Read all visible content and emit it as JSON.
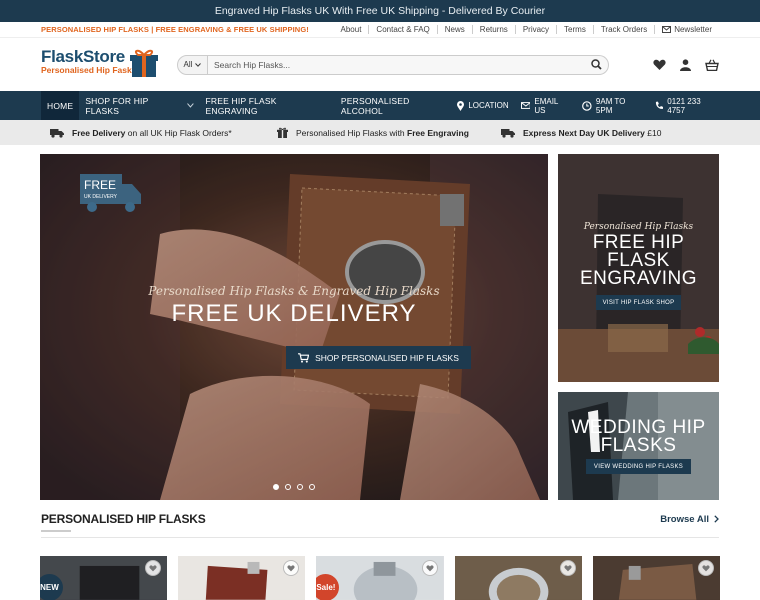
{
  "topbar": {
    "text": "Engraved Hip Flasks UK With Free UK Shipping - Delivered By Courier"
  },
  "secondary_bar": {
    "promo": "PERSONALISED HIP FLASKS | FREE ENGRAVING & FREE UK SHIPPING!",
    "links": [
      "About",
      "Contact & FAQ",
      "News",
      "Returns",
      "Privacy",
      "Terms",
      "Track Orders"
    ],
    "newsletter": "Newsletter"
  },
  "header": {
    "logo_title": "FlaskStore",
    "logo_subtitle": "Personalised Hip Fasks",
    "search_category": "All",
    "search_placeholder": "Search Hip Flasks...",
    "icons": [
      "heart-icon",
      "user-icon",
      "basket-icon"
    ]
  },
  "nav": {
    "items": [
      "HOME",
      "SHOP FOR HIP FLASKS",
      "FREE HIP FLASK ENGRAVING",
      "PERSONALISED ALCOHOL"
    ],
    "right": [
      "LOCATION",
      "EMAIL US",
      "9AM TO 5PM",
      "0121 233 4757"
    ]
  },
  "benefits": {
    "b1_bold": "Free Delivery",
    "b1_rest": " on all UK Hip Flask Orders*",
    "b2_rest": "Personalised Hip Flasks with ",
    "b2_bold": "Free Engraving",
    "b3_bold": "Express Next Day UK Delivery",
    "b3_rest": " £10"
  },
  "hero": {
    "badge_free": "FREE",
    "badge_sub": "UK DELIVERY",
    "script": "Personalised Hip Flasks & Engraved Hip Flasks",
    "title": "FREE UK DELIVERY",
    "button": "SHOP PERSONALISED HIP FLASKS",
    "slides": 4,
    "active_slide": 1
  },
  "side_banner_1": {
    "script": "Personalised Hip Flasks",
    "line1": "FREE HIP",
    "line2": "FLASK",
    "line3": "ENGRAVING",
    "button": "VISIT HIP FLASK SHOP"
  },
  "side_banner_2": {
    "line1": "WEDDING HIP",
    "line2": "FLASKS",
    "button": "VIEW WEDDING HIP FLASKS"
  },
  "section": {
    "title": "PERSONALISED HIP FLASKS",
    "browse_all": "Browse All"
  },
  "cards": {
    "badge_new": "NEW",
    "badge_sale": "Sale!"
  },
  "colors": {
    "navy": "#1d3a4f",
    "orange": "#e0651f",
    "sale_red": "#d2452b"
  }
}
